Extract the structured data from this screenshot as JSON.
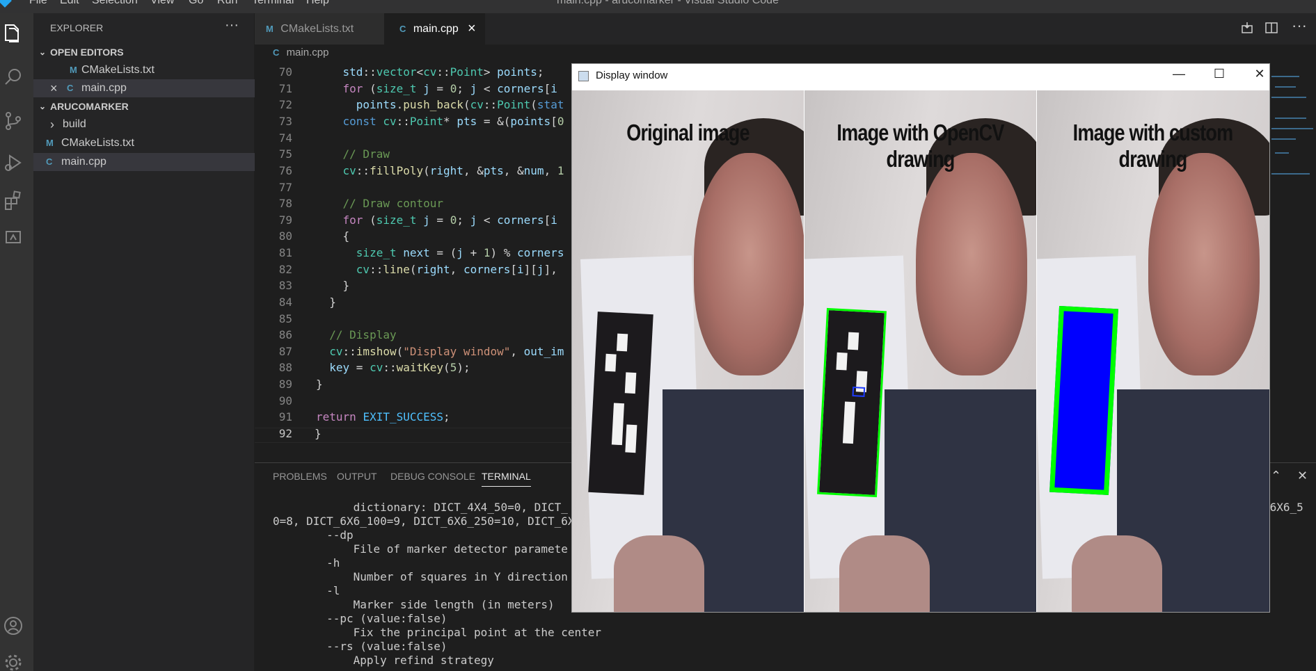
{
  "titlebar": {
    "menu": [
      "File",
      "Edit",
      "Selection",
      "View",
      "Go",
      "Run",
      "Terminal",
      "Help"
    ],
    "title": "main.cpp - arucomarker - Visual Studio Code"
  },
  "activity": [
    "explorer-icon",
    "search-icon",
    "source-control-icon",
    "run-debug-icon",
    "extensions-icon",
    "remote-explorer-icon",
    "account-icon",
    "settings-gear-icon"
  ],
  "sidebar": {
    "title": "EXPLORER",
    "more": "···",
    "open_editors": "OPEN EDITORS",
    "open_items": [
      {
        "icon": "M",
        "label": "CMakeLists.txt"
      },
      {
        "icon": "C",
        "label": "main.cpp",
        "close": "×"
      }
    ],
    "project": "ARUCOMARKER",
    "tree": [
      {
        "type": "folder",
        "label": "build",
        "chev": "›"
      },
      {
        "type": "file",
        "icon": "M",
        "label": "CMakeLists.txt"
      },
      {
        "type": "file",
        "icon": "C",
        "label": "main.cpp"
      }
    ]
  },
  "tabs": [
    {
      "icon": "M",
      "label": "CMakeLists.txt"
    },
    {
      "icon": "C",
      "label": "main.cpp",
      "close": "×"
    }
  ],
  "breadcrumb": {
    "icon": "C",
    "label": "main.cpp"
  },
  "editor": {
    "lines": [
      70,
      71,
      72,
      73,
      74,
      75,
      76,
      77,
      78,
      79,
      80,
      81,
      82,
      83,
      84,
      85,
      86,
      87,
      88,
      89,
      90,
      91,
      92
    ]
  },
  "panel": {
    "tabs": [
      "PROBLEMS",
      "OUTPUT",
      "DEBUG CONSOLE",
      "TERMINAL"
    ],
    "active": "TERMINAL",
    "terminal": [
      "            dictionary: DICT_4X4_50=0, DICT_",
      "0=8, DICT_6X6_100=9, DICT_6X6_250=10, DICT_6X6_1",
      "        --dp",
      "            File of marker detector paramete",
      "        -h",
      "            Number of squares in Y direction",
      "        -l",
      "            Marker side length (in meters)",
      "        --pc (value:false)",
      "            Fix the principal point at the center",
      "        --rs (value:false)",
      "            Apply refind strategy"
    ],
    "right_fragment": "_6X6_5"
  },
  "display_window": {
    "title": "Display window",
    "buttons": {
      "minimize": "—",
      "maximize": "☐",
      "close": "✕"
    },
    "captions": [
      "Original image",
      "Image with OpenCV drawing",
      "Image with custom drawing"
    ],
    "marker_fill_color": "#0000ff",
    "marker_outline_color": "#00ff00"
  }
}
